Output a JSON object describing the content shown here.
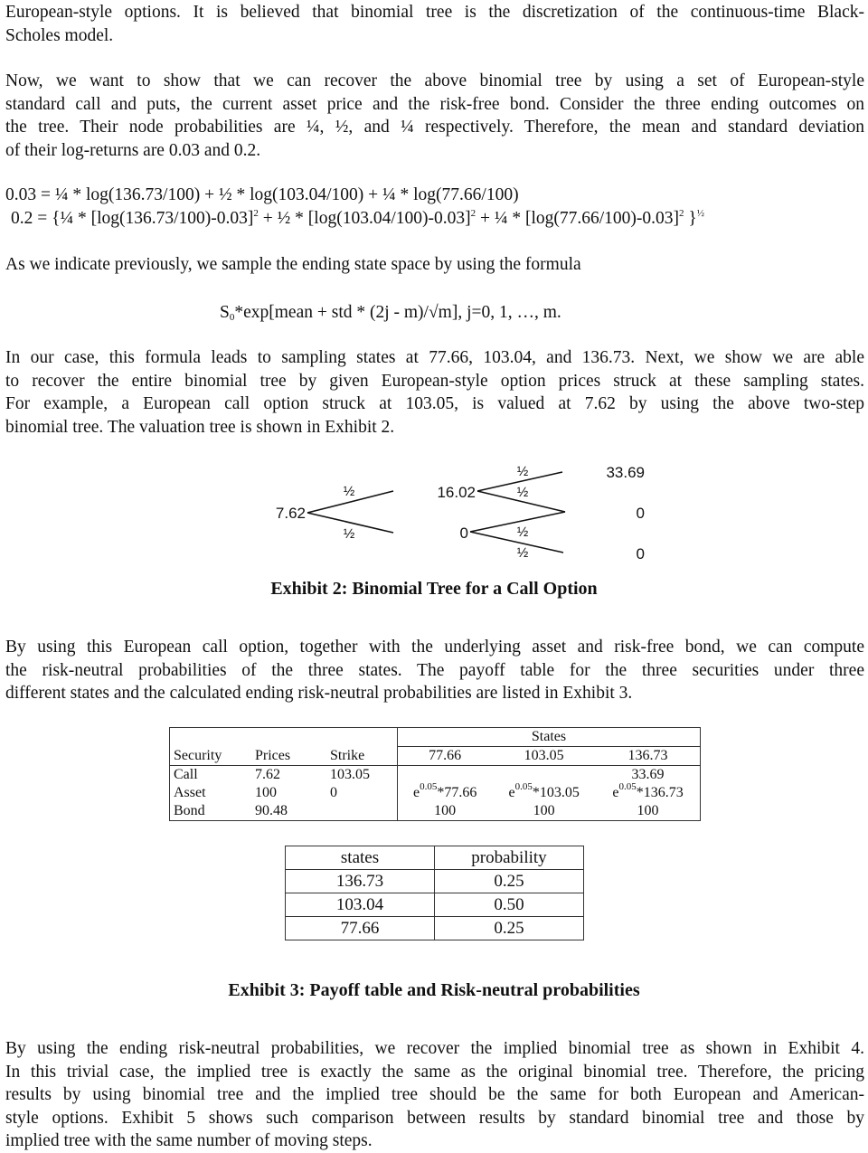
{
  "paragraphs": {
    "p1_lines": [
      "European-style options. It is believed that binomial tree is the discretization of the continuous-time Black-",
      "Scholes model."
    ],
    "p2_lines": [
      "Now, we want to show that we can recover the above binomial tree by using a set of European-style",
      "standard call and puts, the current asset price and the risk-free bond. Consider the three ending outcomes on",
      "the tree. Their node probabilities are ¼, ½, and ¼ respectively. Therefore, the mean and standard deviation",
      "of their log-returns are 0.03 and 0.2."
    ],
    "p3": "As we indicate previously, we sample the ending state space by using the formula",
    "p4_lines": [
      "In our case, this formula leads to sampling states at 77.66, 103.04, and 136.73. Next, we show we are able",
      "to recover the entire binomial tree by given European-style option prices struck at these sampling states.",
      "For example, a European call option struck at 103.05, is valued at 7.62 by using the above two-step",
      "binomial tree. The valuation tree is shown in Exhibit 2."
    ],
    "p5_lines": [
      "By using this European call option, together with the underlying asset and risk-free bond, we can compute",
      "the risk-neutral probabilities of the three states. The payoff table for the three securities under three",
      "different states and the calculated ending risk-neutral probabilities are listed in Exhibit 3."
    ],
    "p6_lines": [
      "By using the ending risk-neutral probabilities, we recover the implied binomial tree as shown in Exhibit 4.",
      "In this trivial case, the implied tree is exactly the same as the original binomial tree. Therefore, the pricing",
      "results by using binomial tree and the implied tree should be the same for both European and American-",
      "style options. Exhibit 5 shows such comparison between results by standard binomial tree and those by",
      "implied tree with the same number of moving steps."
    ]
  },
  "equations": {
    "mean_eq": "0.03 = ¼ * log(136.73/100) +  ½ * log(103.04/100) + ¼ * log(77.66/100)",
    "std_eq_parts": [
      "0.2 = {¼ * [log(136.73/100)-0.03]",
      "2",
      " +  ½ * [log(103.04/100)-0.03]",
      "2",
      " + ¼ * [log(77.66/100)-0.03]",
      "2",
      " }",
      "½"
    ],
    "formula_parts": [
      "S",
      "0",
      "*exp[mean + std * (2j - m)/√m], j=0, 1, …, m."
    ]
  },
  "exhibit2": {
    "caption": "Exhibit 2: Binomial Tree for a Call Option",
    "root": "7.62",
    "mid_up": "16.02",
    "mid_down": "0",
    "end_up": "33.69",
    "end_mid": "0",
    "end_down": "0",
    "prob_label": "½"
  },
  "exhibit3": {
    "caption": "Exhibit 3: Payoff table and Risk-neutral probabilities",
    "payoff_table": {
      "group_header": "States",
      "headers": [
        "Security",
        "Prices",
        "Strike",
        "77.66",
        "103.05",
        "136.73"
      ],
      "rows": [
        {
          "security": "Call",
          "price": "7.62",
          "strike": "103.05",
          "s1": "",
          "s2": "",
          "s3": "33.69"
        },
        {
          "security": "Asset",
          "price": "100",
          "strike": "0",
          "s1_base": "e",
          "s1_exp": "0.05",
          "s1_rest": "*77.66",
          "s2_base": "e",
          "s2_exp": "0.05",
          "s2_rest": "*103.05",
          "s3_base": "e",
          "s3_exp": "0.05",
          "s3_rest": "*136.73"
        },
        {
          "security": "Bond",
          "price": "90.48",
          "strike": "",
          "s1": "100",
          "s2": "100",
          "s3": "100"
        }
      ]
    },
    "prob_table": {
      "headers": [
        "states",
        "probability"
      ],
      "rows": [
        [
          "136.73",
          "0.25"
        ],
        [
          "103.04",
          "0.50"
        ],
        [
          "77.66",
          "0.25"
        ]
      ]
    }
  }
}
